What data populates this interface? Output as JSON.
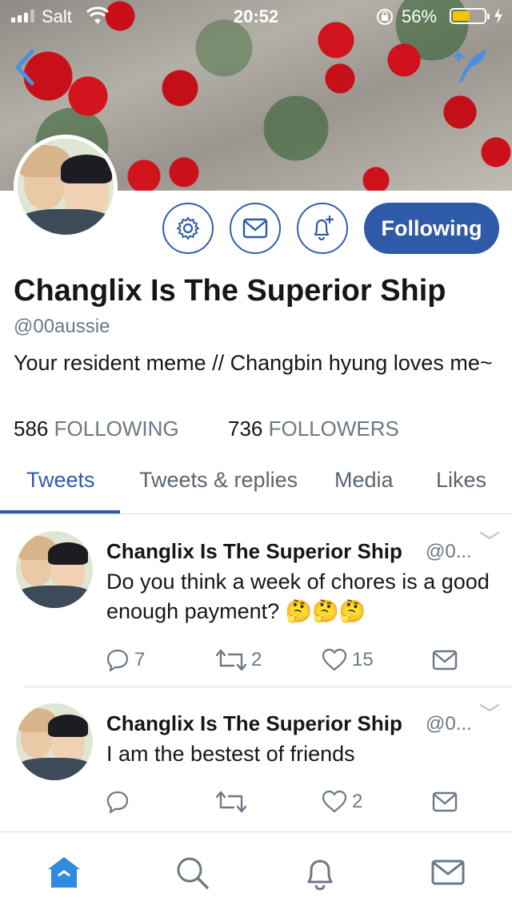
{
  "status_bar": {
    "carrier": "Salt",
    "time": "20:52",
    "battery_percent": "56%",
    "battery_level": 0.56,
    "battery_color": "#f5c400"
  },
  "nav": {
    "back_icon": "chevron-left-icon",
    "compose_icon": "compose-quill-icon"
  },
  "profile": {
    "display_name": "Changlix Is The Superior Ship",
    "handle": "@00aussie",
    "bio": "Your resident meme // Changbin hyung loves me~",
    "following_count": "586",
    "following_label": "FOLLOWING",
    "followers_count": "736",
    "followers_label": "FOLLOWERS",
    "actions": {
      "settings_icon": "gear-icon",
      "message_icon": "envelope-icon",
      "notify_icon": "bell-plus-icon",
      "follow_label": "Following"
    }
  },
  "tabs": [
    {
      "label": "Tweets",
      "active": true
    },
    {
      "label": "Tweets & replies",
      "active": false
    },
    {
      "label": "Media",
      "active": false
    },
    {
      "label": "Likes",
      "active": false
    }
  ],
  "tweets": [
    {
      "name": "Changlix Is The Superior Ship",
      "handle": "@0...",
      "text": "Do you think a week of chores is a good enough payment? 🤔🤔🤔",
      "replies": "7",
      "retweets": "2",
      "likes": "15"
    },
    {
      "name": "Changlix Is The Superior Ship",
      "handle": "@0...",
      "text": "I am the bestest of friends",
      "replies": "",
      "retweets": "",
      "likes": "2"
    }
  ],
  "bottom_nav": [
    {
      "icon": "home-icon",
      "active": true
    },
    {
      "icon": "search-icon",
      "active": false
    },
    {
      "icon": "bell-icon",
      "active": false
    },
    {
      "icon": "envelope-icon",
      "active": false
    }
  ],
  "colors": {
    "accent": "#2f5aa8",
    "secondary_text": "#6b7885"
  }
}
